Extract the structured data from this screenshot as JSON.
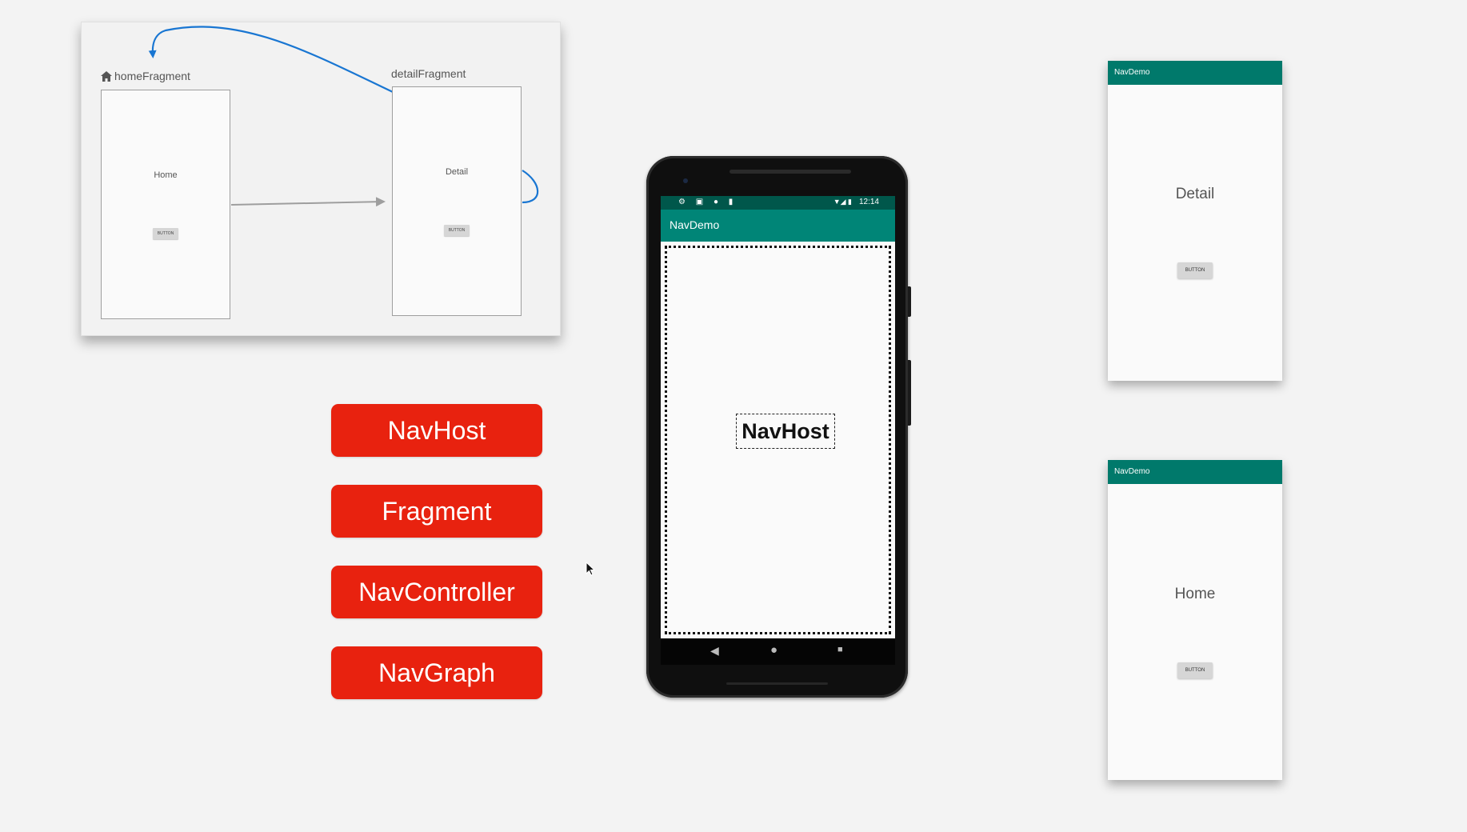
{
  "nav_graph": {
    "home": {
      "label": "homeFragment",
      "text": "Home",
      "button": "BUTTON",
      "icon": "home-icon"
    },
    "detail": {
      "label": "detailFragment",
      "text": "Detail",
      "button": "BUTTON"
    },
    "colors": {
      "action_arrow": "#1976d2",
      "forward_arrow": "#9e9e9e"
    }
  },
  "concepts": [
    "NavHost",
    "Fragment",
    "NavController",
    "NavGraph"
  ],
  "phone": {
    "status_time": "12:14",
    "status_left_icons": "⚙ ▣ ● ▮",
    "status_right_icons": "▼◢ ▮",
    "app_title": "NavDemo",
    "navhost_label": "NavHost"
  },
  "previews": {
    "detail": {
      "app_title": "NavDemo",
      "text": "Detail",
      "button": "BUTTON"
    },
    "home": {
      "app_title": "NavDemo",
      "text": "Home",
      "button": "BUTTON"
    }
  },
  "colors": {
    "concept_red": "#e8220f",
    "app_bar": "#008577",
    "status_bar": "#00574b",
    "background": "#f3f3f3"
  }
}
